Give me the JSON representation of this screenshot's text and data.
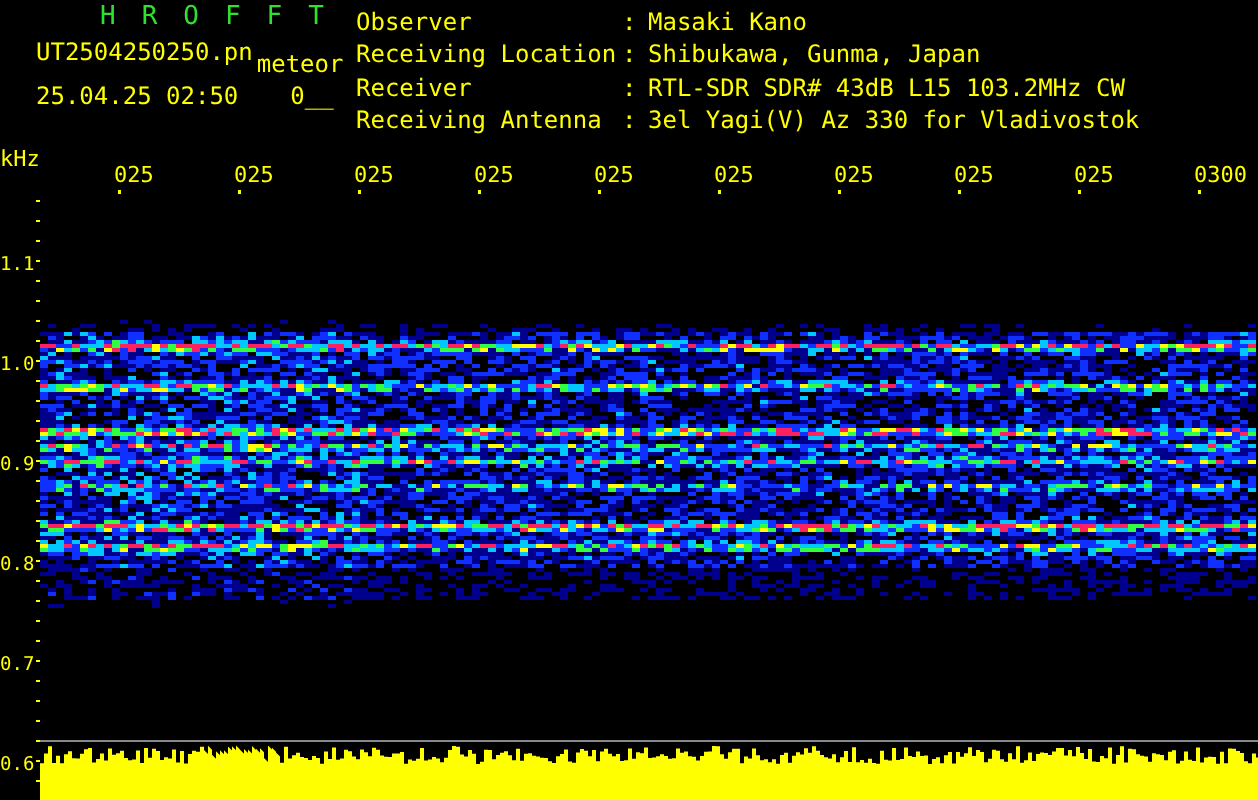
{
  "header": {
    "title": "HROFFT",
    "file_name": "UT2504250250.pn",
    "file_suffix": "meteor",
    "timestamp": "25.04.25 02:50",
    "counter": "0__"
  },
  "station_info": [
    {
      "label": "Observer",
      "separator": ":",
      "value": "Masaki Kano"
    },
    {
      "label": "Receiving Location",
      "separator": ":",
      "value": "Shibukawa, Gunma, Japan"
    },
    {
      "label": "Receiver",
      "separator": ":",
      "value": "RTL-SDR SDR# 43dB L15 103.2MHz CW"
    },
    {
      "label": "Receiving Antenna",
      "separator": ":",
      "value": "3el Yagi(V) Az 330 for Vladivostok"
    }
  ],
  "spectrogram": {
    "frequency_unit": "kHz",
    "time_labels": [
      "025",
      "025",
      "025",
      "025",
      "025",
      "025",
      "025",
      "025",
      "025",
      "0300"
    ],
    "frequency_labels": [
      "1.1",
      "1.0",
      "0.9",
      "0.8",
      "0.7",
      "0.6"
    ]
  }
}
